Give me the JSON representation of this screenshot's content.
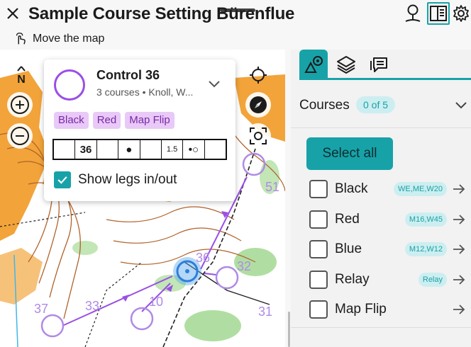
{
  "app": {
    "title": "Sample Course Setting Bürenflue",
    "hint": "Move the map"
  },
  "popup": {
    "title": "Control 36",
    "subtitle": "3 courses • Knoll, W...",
    "chips": [
      "Black",
      "Red",
      "Map Flip"
    ],
    "description": [
      "",
      "36",
      "",
      "●",
      "",
      "1.5",
      "•○",
      ""
    ],
    "show_legs_label": "Show legs in/out",
    "show_legs_checked": true
  },
  "map": {
    "labels": [
      "36",
      "32",
      "31",
      "10",
      "51",
      "37",
      "33"
    ],
    "north_label": "N"
  },
  "panel": {
    "courses_label": "Courses",
    "courses_count": "0 of 5",
    "select_all": "Select all",
    "courses": [
      {
        "name": "Black",
        "classes": "WE,ME,W20"
      },
      {
        "name": "Red",
        "classes": "M16,W45"
      },
      {
        "name": "Blue",
        "classes": "M12,W12"
      },
      {
        "name": "Relay",
        "classes": "Relay"
      },
      {
        "name": "Map Flip",
        "classes": ""
      }
    ]
  },
  "colors": {
    "accent": "#17a2a8",
    "course": "#9a4fe6",
    "chip_bg": "#e8c9f7"
  }
}
